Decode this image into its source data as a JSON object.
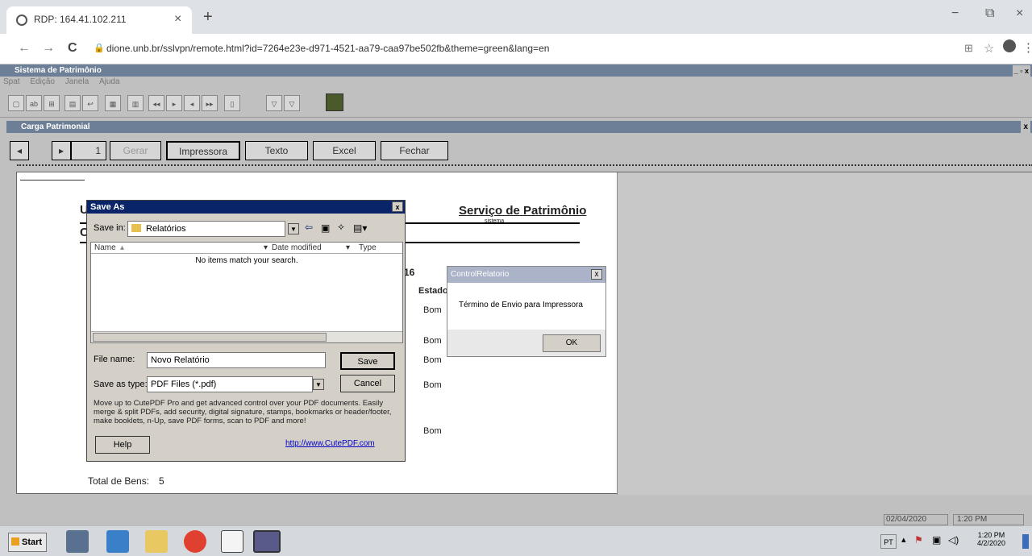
{
  "browser": {
    "tab_title": "RDP: 164.41.102.211",
    "tab_close": "×",
    "new_tab": "+",
    "url": "dione.unb.br/sslvpn/remote.html?id=7264e23e-d971-4521-aa79-caa97be502fb&theme=green&lang=en",
    "back": "←",
    "forward": "→",
    "reload": "C",
    "min": "−",
    "max": "⧉",
    "close": "×"
  },
  "app": {
    "title": "Sistema de Patrimônio",
    "menu": [
      "Spat",
      "Edição",
      "Janela",
      "Ajuda"
    ],
    "child_title": "Carga Patrimonial",
    "child_close": "x",
    "report_toolbar": {
      "page": "1",
      "buttons": [
        "Gerar",
        "Impressora",
        "Texto",
        "Excel",
        "Fechar"
      ]
    },
    "report": {
      "header": "Serviço de Patrimônio",
      "subheader": "sistema",
      "stub_u": "U",
      "stub_c": "C",
      "stub_16": "16",
      "col_estado": "Estado",
      "estado_values": [
        "Bom",
        "Bom",
        "Bom",
        "Bom",
        "Bom"
      ],
      "total_label": "Total de Bens:",
      "total_value": "5"
    },
    "status": {
      "date": "02/04/2020",
      "time": "1:20 PM"
    }
  },
  "save_dialog": {
    "title": "Save As",
    "close": "x",
    "save_in_label": "Save in:",
    "save_in_value": "Relatórios",
    "columns": [
      "Name",
      "Date modified",
      "Type"
    ],
    "empty_text": "No items match your search.",
    "file_name_label": "File name:",
    "file_name_value": "Novo Relatório",
    "save_as_type_label": "Save as type:",
    "save_as_type_value": "PDF Files (*.pdf)",
    "save_button": "Save",
    "cancel_button": "Cancel",
    "promo_text": "Move up to CutePDF Pro and get advanced control over your PDF documents. Easily merge & split PDFs, add security, digital signature, stamps, bookmarks or header/footer, make booklets, n-Up, save PDF forms, scan to PDF and more!",
    "help_button": "Help",
    "link": "http://www.CutePDF.com"
  },
  "control_dialog": {
    "title": "ControlRelatorio",
    "close": "x",
    "message": "Término de Envio para Impressora",
    "ok_button": "OK"
  },
  "taskbar": {
    "start": "Start",
    "lang": "PT",
    "time": "1:20 PM",
    "date": "4/2/2020"
  }
}
